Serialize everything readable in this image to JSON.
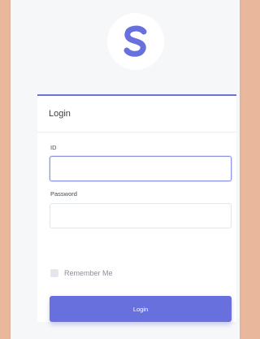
{
  "brand": {
    "logo_letter": "S",
    "accent_color": "#6870dd"
  },
  "login_card": {
    "title": "Login",
    "id_label": "ID",
    "id_value": "",
    "password_label": "Password",
    "password_value": "",
    "remember_label": "Remember Me",
    "remember_checked": false,
    "submit_label": "Login"
  }
}
